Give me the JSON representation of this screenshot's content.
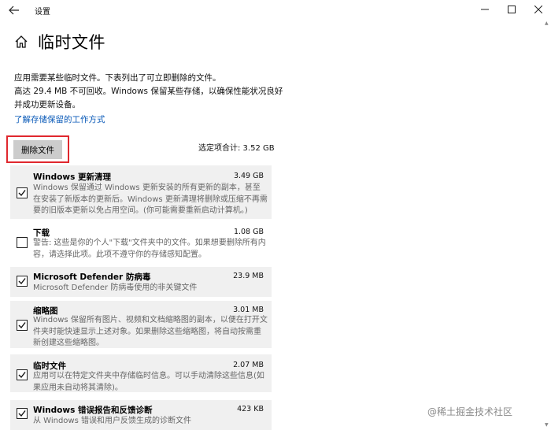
{
  "window": {
    "title": "设置",
    "back_icon": "back-arrow-icon",
    "minimize_icon": "minimize-icon",
    "maximize_icon": "maximize-icon",
    "close_icon": "close-icon"
  },
  "header": {
    "home_icon": "home-icon",
    "title": "临时文件"
  },
  "intro": {
    "line1": "应用需要某些临时文件。下表列出了可立即删除的文件。",
    "line2": "高达 29.4 MB 不可回收。Windows 保留某些存储，以确保性能状况良好并成功更新设备。",
    "link": "了解存储保留的工作方式"
  },
  "actions": {
    "delete_label": "删除文件",
    "selected_total": "选定项合计: 3.52 GB"
  },
  "items": [
    {
      "name": "Windows 更新清理",
      "size": "3.49 GB",
      "checked": true,
      "desc": "Windows 保留通过 Windows 更新安装的所有更新的副本，甚至在安装了新版本的更新后。Windows 更新清理将删除或压缩不再需要的旧版本更新以免占用空间。(你可能需要重新启动计算机。)"
    },
    {
      "name": "下载",
      "size": "1.08 GB",
      "checked": false,
      "desc": "警告: 这些是你的个人\"下载\"文件夹中的文件。如果想要删除所有内容，请选择此项。此项不遵守你的存储感知配置。"
    },
    {
      "name": "Microsoft Defender 防病毒",
      "size": "23.9 MB",
      "checked": true,
      "desc": "Microsoft Defender 防病毒使用的非关键文件"
    },
    {
      "name": "缩略图",
      "size": "3.01 MB",
      "checked": true,
      "desc": "Windows 保留所有图片、视频和文档缩略图的副本，以便在打开文件夹时能快速显示上述对象。如果删除这些缩略图，将自动按需重新创建这些缩略图。"
    },
    {
      "name": "临时文件",
      "size": "2.07 MB",
      "checked": true,
      "desc": "应用可以在特定文件夹中存储临时信息。可以手动清除这些信息(如果应用未自动将其清除)。"
    },
    {
      "name": "Windows 错误报告和反馈诊断",
      "size": "423 KB",
      "checked": true,
      "desc": "从 Windows 错误和用户反馈生成的诊断文件"
    }
  ],
  "watermark": "@稀土掘金技术社区"
}
